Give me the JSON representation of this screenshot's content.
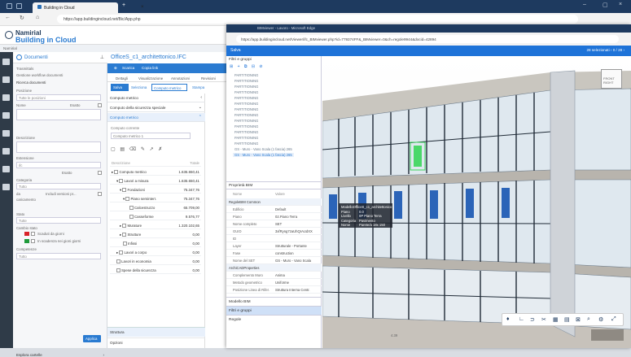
{
  "browser": {
    "tab_title": "Building in Cloud",
    "url": "https://app.buildingincloud.net/Bic/App.php"
  },
  "app": {
    "brand_line1": "Namirial",
    "brand_line2": "Building in Cloud",
    "crumb": "Namirial"
  },
  "filters": {
    "header": "Documenti",
    "rows": [
      {
        "label": "Trasmittals"
      },
      {
        "label": "Gestione workflow documenti"
      }
    ],
    "ricerca": "Ricerca documenti",
    "posizione_label": "Posizione",
    "posizione_value": "Tutte le posizioni",
    "nome_label": "Nome",
    "esatto_label": "Esatto",
    "descrizione_label": "Descrizione",
    "estensione_label": "Estensione",
    "estensione_value": "ifc",
    "esatto2_label": "Esatto",
    "categoria_label": "Categoria",
    "categoria_value": "Tutto",
    "da_label": "da",
    "incluse_label": "Includi versioni pr...",
    "caricamento_label": "caricamento",
    "stato_label": "Stato",
    "stato_value": "Tutte",
    "cambia_stato_label": "Cambio stato",
    "scaduti_label": "Scaduti da giorni",
    "scadenza_label": "In scadenza nei gioni giorni",
    "competenze_label": "Competenze",
    "competenze_value": "Tutto",
    "applica_label": "Applica",
    "esplora_label": "Esplora cartelle"
  },
  "main": {
    "title": "OfficeS_c1_architettonico.IFC",
    "scarica_label": "Scarica",
    "copia_link_label": "Copia link",
    "tabs": [
      "Dettagli",
      "Visualizzazione",
      "Annotazioni",
      "Revisioni"
    ],
    "salva_label": "Salva",
    "seleziona_label": "Seleziona",
    "seleziona_value": "Computo metrico",
    "stampa_label": "Stampa",
    "panel_items": [
      "Computo metrico",
      "Computo della sicurezza speciale",
      "Computo metrico"
    ],
    "computo_corrente_label": "Computo corrente",
    "computo_corrente_value": "Computo metrico 1",
    "grid_header_desc": "Descrizione",
    "grid_header_tot": "Totale",
    "grid_rows": [
      {
        "name": "Computo metrico",
        "value": "1.635.650,41"
      },
      {
        "name": "Lavori a misura",
        "value": "1.635.650,41"
      },
      {
        "name": "Fondazioni",
        "value": "75.347,76"
      },
      {
        "name": "Piano seminterr.",
        "value": "75.347,76"
      },
      {
        "name": "Calcestruzzo",
        "value": "65.709,00"
      },
      {
        "name": "Casseforme",
        "value": "9.576,77"
      },
      {
        "name": "Murature",
        "value": "1.320.102,65"
      },
      {
        "name": "Strutture",
        "value": "0,00"
      },
      {
        "name": "Infissi",
        "value": "0,00"
      },
      {
        "name": "Lavori a corpo",
        "value": "0,00"
      },
      {
        "name": "Lavori in economia",
        "value": "0,00"
      },
      {
        "name": "Spese della sicurezza",
        "value": "0,00"
      }
    ],
    "struttura_label": "Struttura",
    "opzioni_label": "Opzioni"
  },
  "bim": {
    "window_title": "BIMviewer - Lavoro - Microsoft Edge",
    "url": "https://app.buildingincloud.net/Viewer/ifc_BIMviewer.php?id=779374FF&_BIMviewer=0&ch=regole9944&docid=42894",
    "salva_label": "Salva",
    "selection_summary": "28 selezionati",
    "pager": "0 / 28",
    "filtri_gruppi_label": "Filtri e gruppi",
    "tree_items": [
      "PARTITIONING",
      "PARTITIONING",
      "PARTITIONING",
      "PARTITIONING",
      "PARTITIONING",
      "PARTITIONING",
      "PARTITIONING",
      "PARTITIONING",
      "PARTITIONING",
      "PARTITIONING",
      "PARTITIONING",
      "PARTITIONING",
      "PARTITIONING",
      "GS - Muro - Vano Scala (1 fascia) 265",
      "GS - Muro - Vano Scala (1 fascia) 265"
    ],
    "proprieta_label": "Proprietà BIM",
    "prop_header_nome": "Nome",
    "prop_header_valore": "Valore",
    "props": [
      {
        "k": "RegoleBIM Common",
        "v": "",
        "section": true
      },
      {
        "k": "Edificio",
        "v": "Default"
      },
      {
        "k": "Piano",
        "v": "02.Piano Terra"
      },
      {
        "k": "Nome completo",
        "v": "SET"
      },
      {
        "k": "GUID",
        "v": "3xfRyng7zaUhQrAUdXX"
      },
      {
        "k": "ID",
        "v": ""
      },
      {
        "k": "Layer",
        "v": "Strutturale - Portante"
      },
      {
        "k": "Fase",
        "v": "construction"
      },
      {
        "k": "Nome del SET",
        "v": "GS - Muro - Vano Scala"
      },
      {
        "k": "ArchiCADProperties",
        "v": "",
        "section": true
      },
      {
        "k": "Complemento Muro",
        "v": "Anima"
      },
      {
        "k": "Metodo geometrico",
        "v": "Uniforme"
      },
      {
        "k": "Posizione Linea di Rifer.",
        "v": "Struttura Interna Centr."
      }
    ],
    "modello_label": "Modello BIM",
    "filtri_label": "Filtri e gruppi",
    "regole_label": "Regole",
    "tooltip": [
      {
        "k": "Modello",
        "v": "OfficeS_c1_architettonico"
      },
      {
        "k": "Piano",
        "v": "0.0"
      },
      {
        "k": "Livello",
        "v": "0P Piano Terra"
      },
      {
        "k": "Categoria",
        "v": "Pavimento"
      },
      {
        "k": "Nome",
        "v": "Parete/a 18x 150"
      }
    ],
    "meta_value": "4.39"
  }
}
